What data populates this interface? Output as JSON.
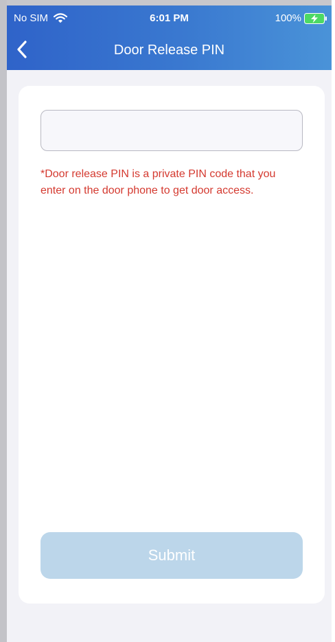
{
  "status_bar": {
    "carrier": "No SIM",
    "time": "6:01 PM",
    "battery_percent": "100%",
    "wifi_icon": "wifi-icon",
    "battery_icon": "battery-charging-icon"
  },
  "nav": {
    "title": "Door Release PIN",
    "back_icon": "chevron-left-icon"
  },
  "form": {
    "pin_value": "",
    "pin_placeholder": "",
    "note": "*Door release PIN is a private PIN code that you enter on the door phone to get door access.",
    "submit_label": "Submit"
  },
  "colors": {
    "header_start": "#2f63c9",
    "header_end": "#4a93d8",
    "note_text": "#d4392f",
    "submit_disabled_bg": "#bcd6ea",
    "page_bg": "#f2f2f7",
    "battery_fill": "#4cd964"
  }
}
